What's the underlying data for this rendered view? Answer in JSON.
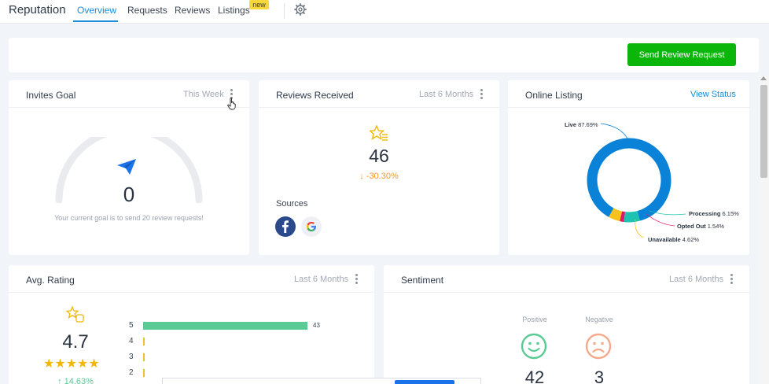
{
  "nav": {
    "brand": "Reputation",
    "tabs": [
      "Overview",
      "Requests",
      "Reviews",
      "Listings"
    ],
    "new_badge": "new",
    "settings_icon": "gear-icon"
  },
  "actions": {
    "send_label": "Send Review Request"
  },
  "invites": {
    "title": "Invites Goal",
    "period": "This Week",
    "value": "0",
    "note": "Your current goal is to send 20 review requests!"
  },
  "reviews": {
    "title": "Reviews Received",
    "period": "Last 6 Months",
    "value": "46",
    "change": "-30.30%",
    "sources_label": "Sources",
    "sources": [
      "facebook",
      "google"
    ]
  },
  "listing": {
    "title": "Online Listing",
    "link": "View Status",
    "segments": [
      {
        "name": "Live",
        "pct": "87.69%",
        "value": 87.69,
        "color": "#0a82d8"
      },
      {
        "name": "Processing",
        "pct": "6.15%",
        "value": 6.15,
        "color": "#1cc3b0"
      },
      {
        "name": "Opted Out",
        "pct": "1.54%",
        "value": 1.54,
        "color": "#e0176a"
      },
      {
        "name": "Unavailable",
        "pct": "4.62%",
        "value": 4.62,
        "color": "#f6c21c"
      }
    ]
  },
  "rating": {
    "title": "Avg. Rating",
    "period": "Last 6 Months",
    "value": "4.7",
    "stars": 4.7,
    "change": "14.63%",
    "bars": [
      {
        "label": "5",
        "count": "43",
        "value": 43
      },
      {
        "label": "4",
        "count": "",
        "value": 0
      },
      {
        "label": "3",
        "count": "",
        "value": 0
      },
      {
        "label": "2",
        "count": "",
        "value": 0
      }
    ],
    "bar_color": "#5bcb95",
    "empty_color": "#f0c02a"
  },
  "sentiment": {
    "title": "Sentiment",
    "period": "Last 6 Months",
    "positive_label": "Positive",
    "negative_label": "Negative",
    "positive_value": "42",
    "negative_value": "3",
    "positive_color": "#5bcb95",
    "negative_color": "#f5a98a"
  }
}
